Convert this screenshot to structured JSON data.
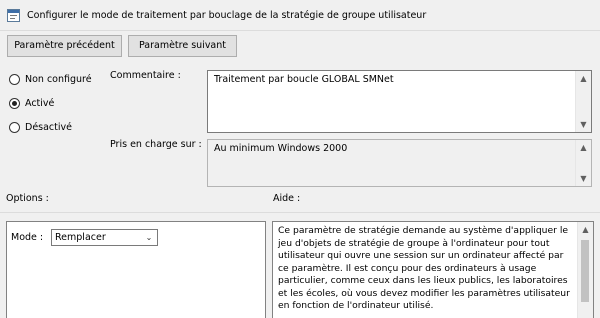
{
  "header": {
    "title": "Configurer le mode de traitement par bouclage de la stratégie de groupe utilisateur"
  },
  "nav": {
    "prev_label": "Paramètre précédent",
    "next_label": "Paramètre suivant"
  },
  "state": {
    "options": [
      {
        "label": "Non configuré",
        "checked": false
      },
      {
        "label": "Activé",
        "checked": true
      },
      {
        "label": "Désactivé",
        "checked": false
      }
    ]
  },
  "comment": {
    "label": "Commentaire :",
    "value": "Traitement par boucle GLOBAL SMNet"
  },
  "supported": {
    "label": "Pris en charge sur :",
    "value": "Au minimum Windows 2000"
  },
  "options_panel": {
    "label": "Options :",
    "mode_label": "Mode :",
    "mode_value": "Remplacer"
  },
  "help_panel": {
    "label": "Aide :",
    "text": "Ce paramètre de stratégie demande au système d'appliquer le jeu d'objets de stratégie de groupe à l'ordinateur pour tout utilisateur qui ouvre une session sur un ordinateur affecté par ce paramètre. Il est conçu pour des ordinateurs à usage particulier, comme ceux dans les lieux publics, les laboratoires et les écoles, où vous devez modifier les paramètres utilisateur en fonction de l'ordinateur utilisé."
  },
  "icons": {
    "header": "policy-setting-icon",
    "scroll_up": "scroll-up-arrow-icon",
    "scroll_down": "scroll-down-arrow-icon",
    "dropdown": "chevron-down-icon"
  }
}
